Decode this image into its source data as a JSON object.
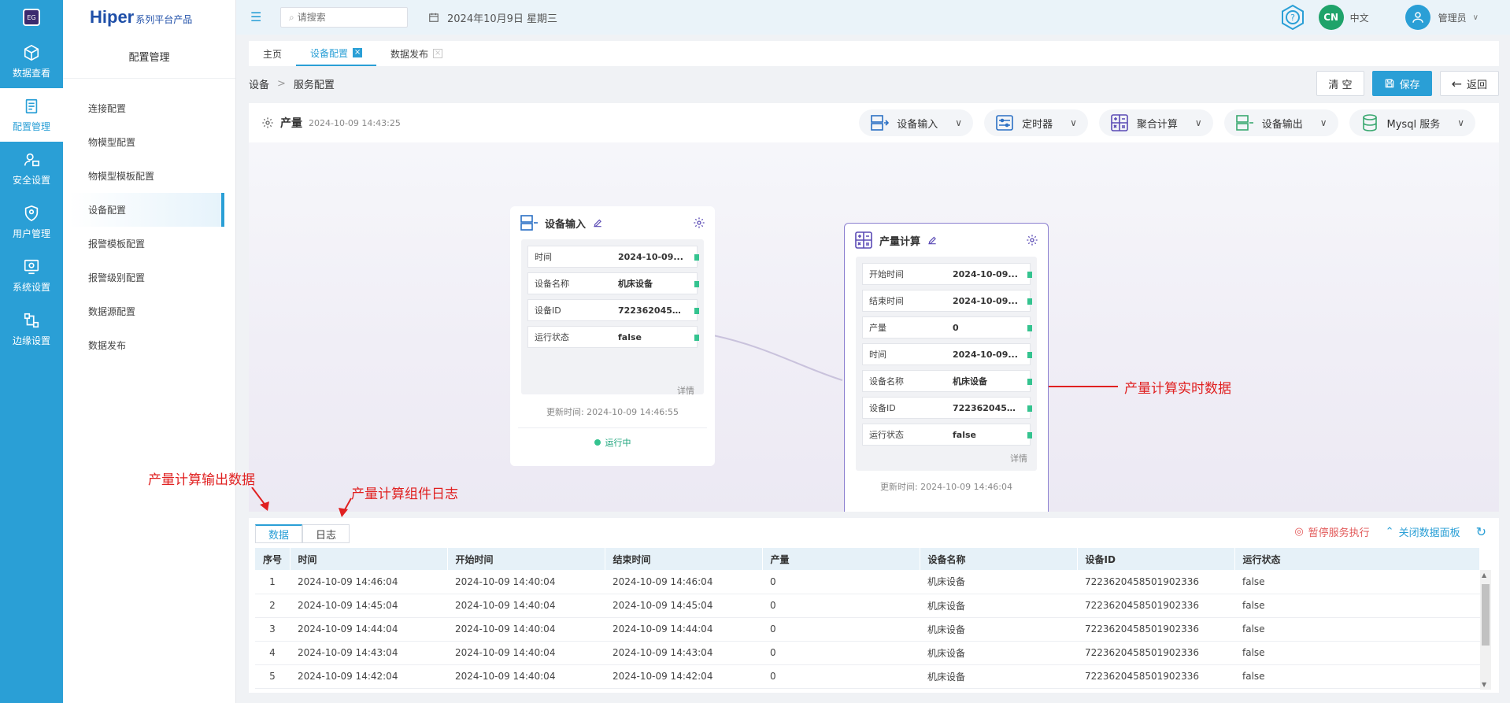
{
  "rail": {
    "items": [
      {
        "label": "数据查看",
        "icon": "cube-icon"
      },
      {
        "label": "配置管理",
        "icon": "config-doc-icon",
        "active": true
      },
      {
        "label": "安全设置",
        "icon": "user-lock-icon"
      },
      {
        "label": "用户管理",
        "icon": "shield-user-icon"
      },
      {
        "label": "系统设置",
        "icon": "system-settings-icon"
      },
      {
        "label": "边缘设置",
        "icon": "edge-network-icon"
      }
    ]
  },
  "brand": {
    "name": "Hiper",
    "suffix": "系列平台产品"
  },
  "subnav": {
    "title": "配置管理",
    "items": [
      "连接配置",
      "物模型配置",
      "物模型模板配置",
      "设备配置",
      "报警模板配置",
      "报警级别配置",
      "数据源配置",
      "数据发布"
    ],
    "active": "设备配置"
  },
  "topbar": {
    "search_placeholder": "请搜索",
    "date": "2024年10月9日 星期三",
    "lang_badge": "CN",
    "lang_label": "中文",
    "user": "管理员"
  },
  "tabs": [
    "主页",
    "设备配置",
    "数据发布"
  ],
  "breadcrumb": {
    "root": "设备",
    "sep": ">",
    "current": "服务配置"
  },
  "actions": {
    "clear": "清 空",
    "save": "保存",
    "back": "返回"
  },
  "flow": {
    "name": "产量",
    "time": "2024-10-09 14:43:25",
    "components": [
      "设备输入",
      "定时器",
      "聚合计算",
      "设备输出",
      "Mysql 服务"
    ]
  },
  "node_input": {
    "title": "设备输入",
    "fields": [
      {
        "k": "时间",
        "v": "2024-10-09..."
      },
      {
        "k": "设备名称",
        "v": "机床设备"
      },
      {
        "k": "设备ID",
        "v": "7223620458..."
      },
      {
        "k": "运行状态",
        "v": "false"
      }
    ],
    "detail": "详情",
    "updated": "更新时间: 2024-10-09 14:46:55",
    "status": "运行中"
  },
  "node_calc": {
    "title": "产量计算",
    "fields": [
      {
        "k": "开始时间",
        "v": "2024-10-09..."
      },
      {
        "k": "结束时间",
        "v": "2024-10-09..."
      },
      {
        "k": "产量",
        "v": "0"
      },
      {
        "k": "时间",
        "v": "2024-10-09..."
      },
      {
        "k": "设备名称",
        "v": "机床设备"
      },
      {
        "k": "设备ID",
        "v": "7223620458..."
      },
      {
        "k": "运行状态",
        "v": "false"
      }
    ],
    "detail": "详情",
    "updated": "更新时间: 2024-10-09 14:46:04"
  },
  "annotations": {
    "realtime": "产量计算实时数据",
    "output": "产量计算输出数据",
    "log": "产量计算组件日志"
  },
  "panel": {
    "tabs": [
      "数据",
      "日志"
    ],
    "pause": "暂停服务执行",
    "close": "关闭数据面板",
    "columns": [
      "序号",
      "时间",
      "开始时间",
      "结束时间",
      "产量",
      "设备名称",
      "设备ID",
      "运行状态"
    ],
    "rows": [
      [
        "1",
        "2024-10-09 14:46:04",
        "2024-10-09 14:40:04",
        "2024-10-09 14:46:04",
        "0",
        "机床设备",
        "7223620458501902336",
        "false"
      ],
      [
        "2",
        "2024-10-09 14:45:04",
        "2024-10-09 14:40:04",
        "2024-10-09 14:45:04",
        "0",
        "机床设备",
        "7223620458501902336",
        "false"
      ],
      [
        "3",
        "2024-10-09 14:44:04",
        "2024-10-09 14:40:04",
        "2024-10-09 14:44:04",
        "0",
        "机床设备",
        "7223620458501902336",
        "false"
      ],
      [
        "4",
        "2024-10-09 14:43:04",
        "2024-10-09 14:40:04",
        "2024-10-09 14:43:04",
        "0",
        "机床设备",
        "7223620458501902336",
        "false"
      ],
      [
        "5",
        "2024-10-09 14:42:04",
        "2024-10-09 14:40:04",
        "2024-10-09 14:42:04",
        "0",
        "机床设备",
        "7223620458501902336",
        "false"
      ]
    ]
  },
  "colors": {
    "primary": "#2a9fd6",
    "accent": "#5b4bb5",
    "ok": "#34c38f",
    "annotation": "#e02020"
  }
}
